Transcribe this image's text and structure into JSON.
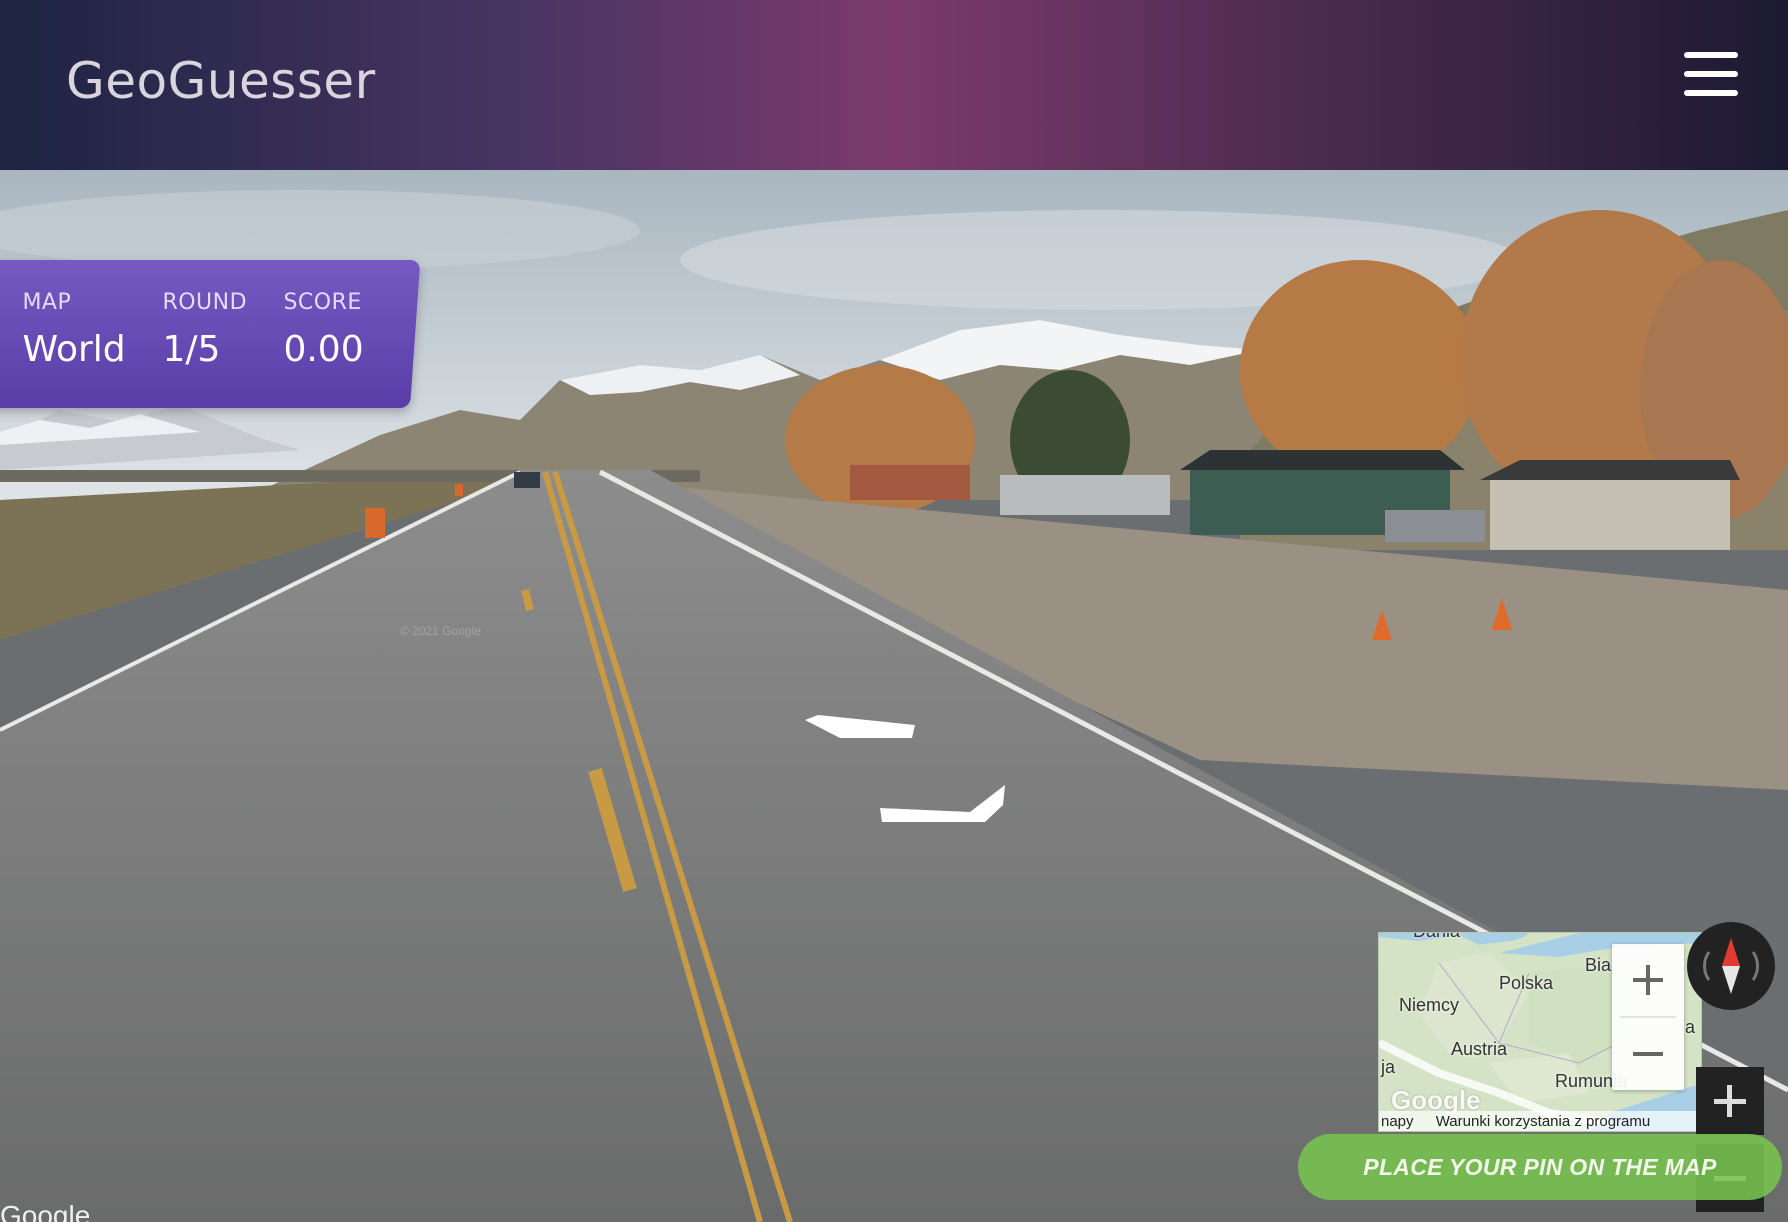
{
  "header": {
    "logo": "GeoGuesser",
    "menu_icon": "hamburger-menu-icon"
  },
  "game_status": {
    "map_label": "MAP",
    "map_value": "World",
    "round_label": "ROUND",
    "round_value": "1/5",
    "score_label": "SCORE",
    "score_value": "0.00"
  },
  "minimap": {
    "labels": {
      "dania": "Dania",
      "polska": "Polska",
      "niemcy": "Niemcy",
      "austria": "Austria",
      "rumunia": "Rumunia",
      "bia": "Bia",
      "ja": "ja",
      "a": "a"
    },
    "logo": "Google",
    "footer_left": "napy",
    "footer_terms": "Warunki korzystania z programu"
  },
  "controls": {
    "map_zoom_in": "+",
    "map_zoom_out": "−",
    "compass_icon": "compass-icon",
    "sv_zoom_in": "+",
    "sv_zoom_out": "−"
  },
  "pin_button": "PLACE YOUR PIN ON THE MAP",
  "street_view": {
    "watermark": "© 2021 Google",
    "corner_mark": "Google"
  },
  "colors": {
    "panel": "#6a4dbb",
    "pin_button": "#78c450",
    "header_center": "#7c3a6c"
  }
}
